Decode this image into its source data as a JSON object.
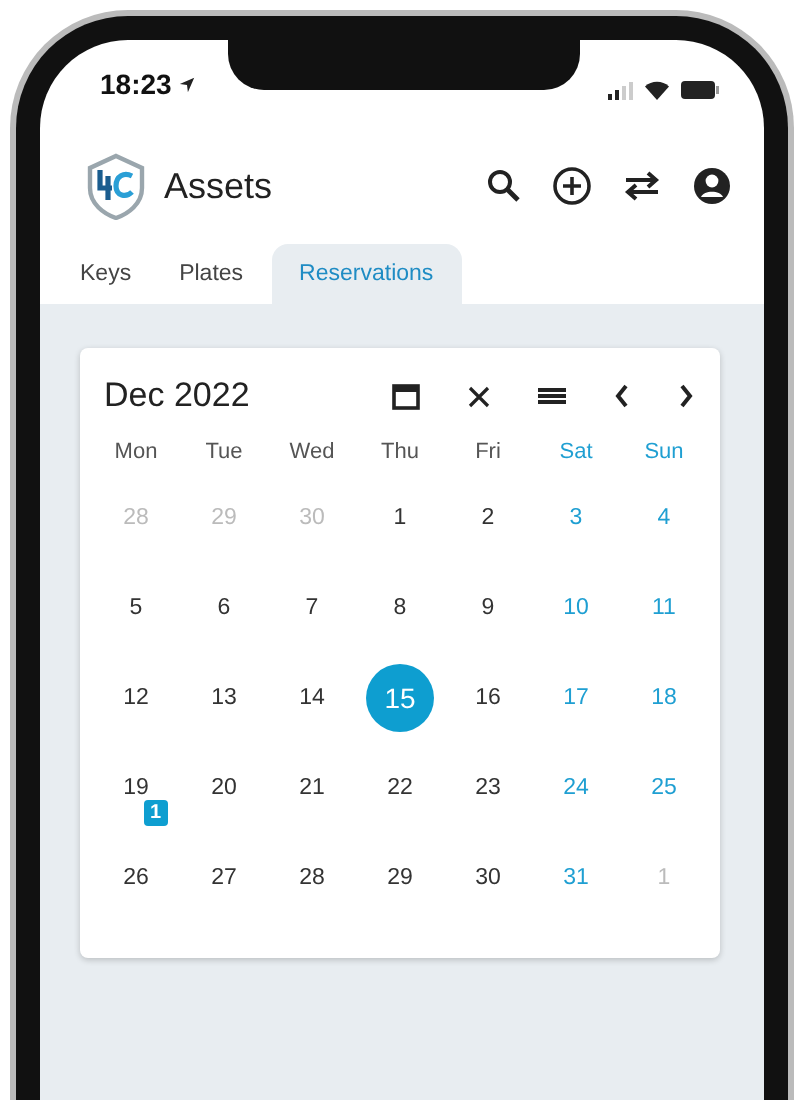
{
  "status_bar": {
    "time": "18:23"
  },
  "header": {
    "title": "Assets"
  },
  "tabs": [
    {
      "label": "Keys",
      "selected": false
    },
    {
      "label": "Plates",
      "selected": false
    },
    {
      "label": "Reservations",
      "selected": true
    }
  ],
  "calendar": {
    "month": "Dec 2022",
    "weekdays": [
      {
        "label": "Mon",
        "kind": "weekday"
      },
      {
        "label": "Tue",
        "kind": "weekday"
      },
      {
        "label": "Wed",
        "kind": "weekday"
      },
      {
        "label": "Thu",
        "kind": "weekday"
      },
      {
        "label": "Fri",
        "kind": "weekday"
      },
      {
        "label": "Sat",
        "kind": "weekend"
      },
      {
        "label": "Sun",
        "kind": "weekend"
      }
    ],
    "days": [
      {
        "label": "28",
        "kind": "outside",
        "selected": false
      },
      {
        "label": "29",
        "kind": "outside",
        "selected": false
      },
      {
        "label": "30",
        "kind": "outside",
        "selected": false
      },
      {
        "label": "1",
        "kind": "weekday",
        "selected": false
      },
      {
        "label": "2",
        "kind": "weekday",
        "selected": false
      },
      {
        "label": "3",
        "kind": "weekend",
        "selected": false
      },
      {
        "label": "4",
        "kind": "weekend",
        "selected": false
      },
      {
        "label": "5",
        "kind": "weekday",
        "selected": false
      },
      {
        "label": "6",
        "kind": "weekday",
        "selected": false
      },
      {
        "label": "7",
        "kind": "weekday",
        "selected": false
      },
      {
        "label": "8",
        "kind": "weekday",
        "selected": false
      },
      {
        "label": "9",
        "kind": "weekday",
        "selected": false
      },
      {
        "label": "10",
        "kind": "weekend",
        "selected": false
      },
      {
        "label": "11",
        "kind": "weekend",
        "selected": false
      },
      {
        "label": "12",
        "kind": "weekday",
        "selected": false
      },
      {
        "label": "13",
        "kind": "weekday",
        "selected": false
      },
      {
        "label": "14",
        "kind": "weekday",
        "selected": false
      },
      {
        "label": "15",
        "kind": "weekday",
        "selected": true
      },
      {
        "label": "16",
        "kind": "weekday",
        "selected": false
      },
      {
        "label": "17",
        "kind": "weekend",
        "selected": false
      },
      {
        "label": "18",
        "kind": "weekend",
        "selected": false
      },
      {
        "label": "19",
        "kind": "weekday",
        "selected": false,
        "badge": "1"
      },
      {
        "label": "20",
        "kind": "weekday",
        "selected": false
      },
      {
        "label": "21",
        "kind": "weekday",
        "selected": false
      },
      {
        "label": "22",
        "kind": "weekday",
        "selected": false
      },
      {
        "label": "23",
        "kind": "weekday",
        "selected": false
      },
      {
        "label": "24",
        "kind": "weekend",
        "selected": false
      },
      {
        "label": "25",
        "kind": "weekend",
        "selected": false
      },
      {
        "label": "26",
        "kind": "weekday",
        "selected": false
      },
      {
        "label": "27",
        "kind": "weekday",
        "selected": false
      },
      {
        "label": "28",
        "kind": "weekday",
        "selected": false
      },
      {
        "label": "29",
        "kind": "weekday",
        "selected": false
      },
      {
        "label": "30",
        "kind": "weekday",
        "selected": false
      },
      {
        "label": "31",
        "kind": "weekend",
        "selected": false
      },
      {
        "label": "1",
        "kind": "outside",
        "selected": false
      }
    ]
  }
}
